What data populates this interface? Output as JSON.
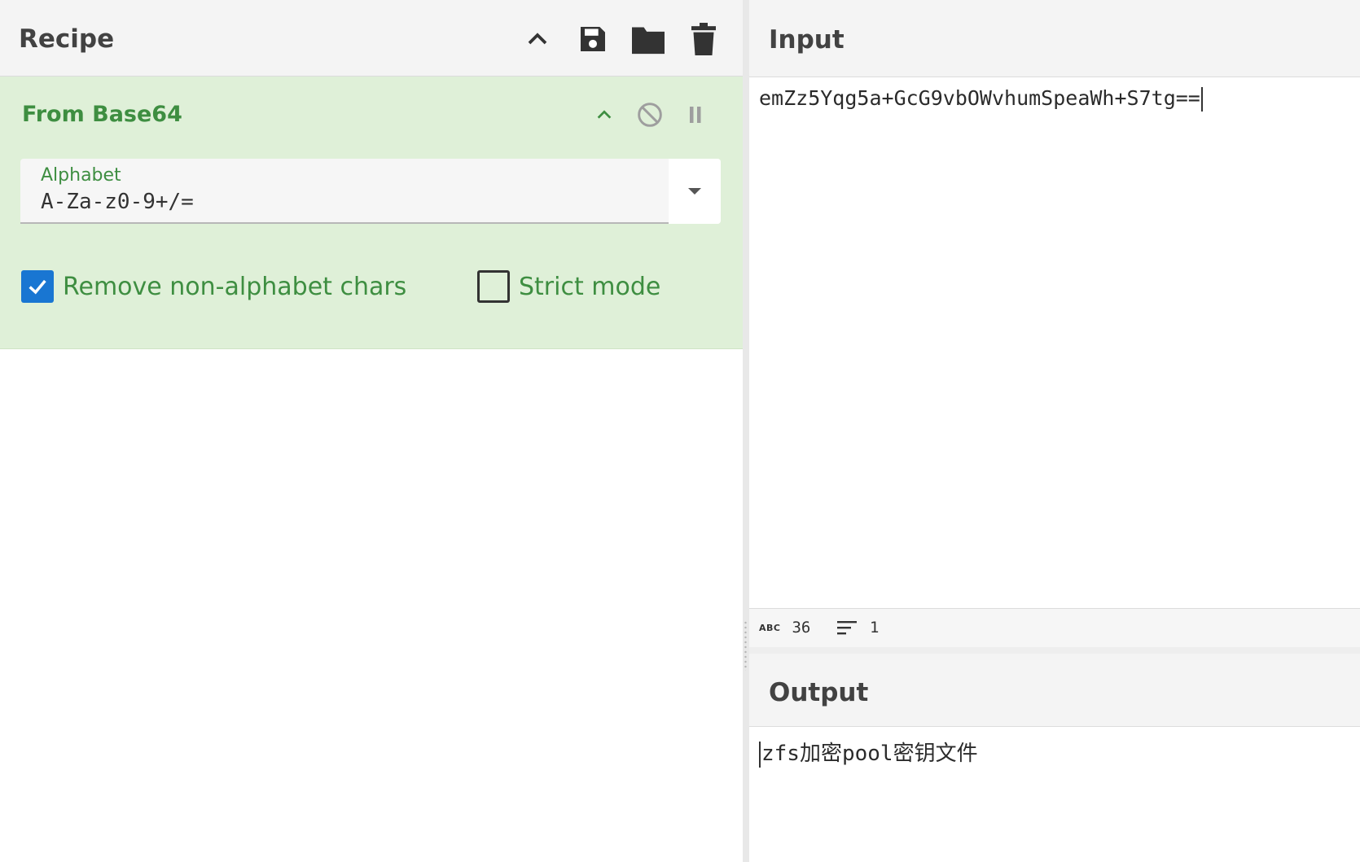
{
  "recipe": {
    "title": "Recipe",
    "header_icons": [
      "chevron-up-icon",
      "save-icon",
      "folder-icon",
      "trash-icon"
    ]
  },
  "operation": {
    "title": "From Base64",
    "controls": [
      "chevron-up-icon",
      "disable-icon",
      "pause-icon"
    ],
    "alphabet": {
      "label": "Alphabet",
      "value": "A-Za-z0-9+/="
    },
    "remove_non_alphabet": {
      "label": "Remove non-alphabet chars",
      "checked": true
    },
    "strict_mode": {
      "label": "Strict mode",
      "checked": false
    }
  },
  "input": {
    "title": "Input",
    "text": "emZz5Yqg5a+GcG9vbOWvhumSpeaWh+S7tg==",
    "stats": {
      "length": "36",
      "lines": "1"
    }
  },
  "output": {
    "title": "Output",
    "text": "zfs加密pool密钥文件"
  },
  "colors": {
    "accent_green": "#3e8e41",
    "operation_bg": "#dff0d8",
    "checkbox_blue": "#1976d2",
    "header_bg": "#f4f4f4"
  }
}
